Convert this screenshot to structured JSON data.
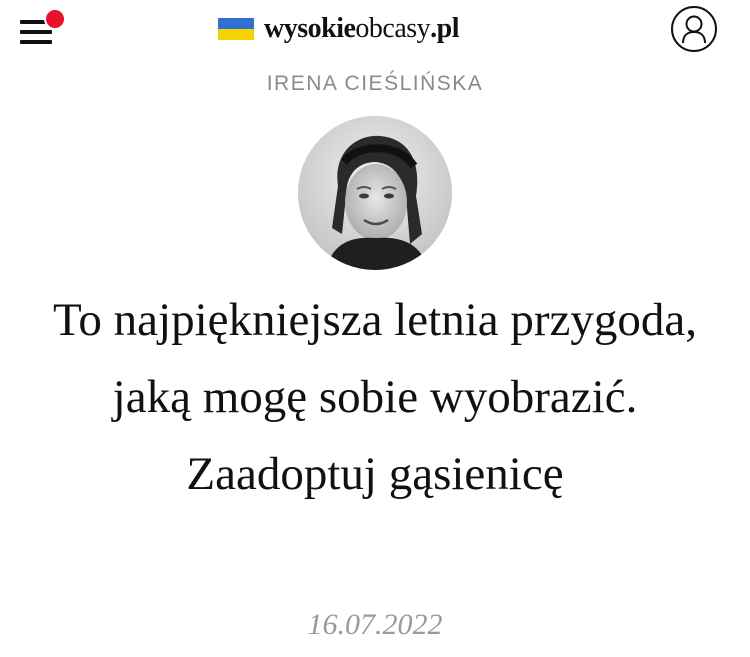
{
  "header": {
    "logo_bold": "wysokie",
    "logo_light": "obcasy",
    "logo_tld": ".pl",
    "menu_icon": "hamburger-menu-icon",
    "notification_color": "#e8102a",
    "user_icon": "user-account-icon",
    "flag_colors": [
      "#2f6fd6",
      "#f5d300"
    ]
  },
  "article": {
    "author": "IRENA CIEŚLIŃSKA",
    "headline": "To najpiękniejsza letnia przygoda, jaką mogę sobie wyobrazić. Zaadoptuj gąsienicę",
    "date": "16.07.2022"
  }
}
